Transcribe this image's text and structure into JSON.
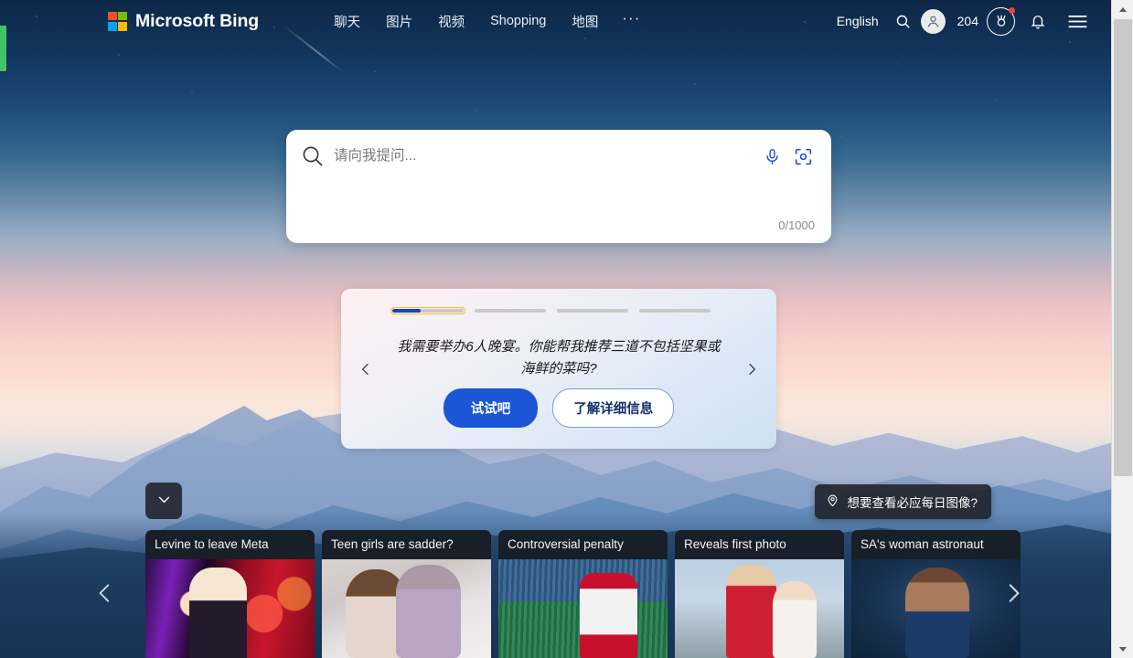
{
  "header": {
    "brand": "Microsoft Bing",
    "logo_icon": "microsoft-logo-icon",
    "nav": [
      {
        "label": "聊天",
        "name": "nav-chat"
      },
      {
        "label": "图片",
        "name": "nav-images"
      },
      {
        "label": "视频",
        "name": "nav-videos"
      },
      {
        "label": "Shopping",
        "name": "nav-shopping"
      },
      {
        "label": "地图",
        "name": "nav-maps"
      },
      {
        "label": "···",
        "name": "nav-more"
      }
    ],
    "language": "English",
    "search_icon": "search-icon",
    "avatar_icon": "account-avatar-icon",
    "points": "204",
    "rewards_icon": "rewards-medal-icon",
    "rewards_badge": "new-notification-dot",
    "notifications_icon": "bell-icon",
    "menu_icon": "hamburger-menu-icon"
  },
  "search": {
    "glass_icon": "search-icon",
    "placeholder": "请向我提问...",
    "value": "",
    "mic_icon": "microphone-icon",
    "camera_icon": "visual-search-camera-icon",
    "char_count": "0/1000"
  },
  "promo": {
    "progress": [
      {
        "percent": 40,
        "active": true
      },
      {
        "percent": 0,
        "active": false
      },
      {
        "percent": 0,
        "active": false
      },
      {
        "percent": 0,
        "active": false
      }
    ],
    "text": "我需要举办6人晚宴。你能帮我推荐三道不包括坚果或海鲜的菜吗?",
    "try_label": "试试吧",
    "learn_label": "了解详细信息",
    "prev_icon": "chevron-left-icon",
    "next_icon": "chevron-right-icon",
    "accent_color": "#1a56d6",
    "bar_fill_color": "#1243c9",
    "focus_ring_color": "#f0c419"
  },
  "daily_image_tip": {
    "icon": "location-pin-icon",
    "text": "想要查看必应每日图像?"
  },
  "expand_button": {
    "icon": "chevron-down-icon"
  },
  "news": {
    "prev_icon": "chevron-left-icon",
    "next_icon": "chevron-right-icon",
    "cards": [
      {
        "title": "Levine to leave Meta",
        "thumb": "thumb-1"
      },
      {
        "title": "Teen girls are sadder?",
        "thumb": "thumb-2"
      },
      {
        "title": "Controversial penalty",
        "thumb": "thumb-3"
      },
      {
        "title": "Reveals first photo",
        "thumb": "thumb-4"
      },
      {
        "title": "SA's woman astronaut",
        "thumb": "thumb-5"
      }
    ]
  },
  "scrollbar": {
    "up_icon": "scroll-up-arrow-icon",
    "down_icon": "scroll-down-arrow-icon"
  },
  "edge_marker": {
    "color": "#3fc46a"
  }
}
